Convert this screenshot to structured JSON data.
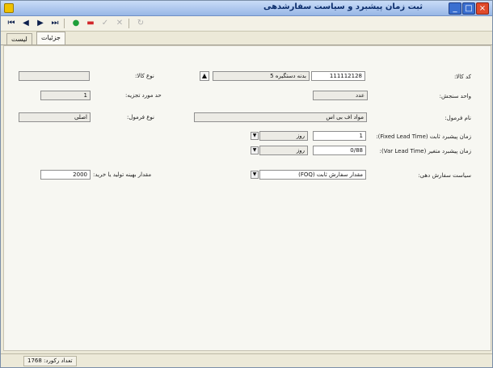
{
  "window": {
    "title": "ثبت زمان پیشبرد و سیاست سفارشدهی",
    "close": "×",
    "maximize": "□",
    "minimize": "_"
  },
  "toolbar": {
    "first": "⏮",
    "prev": "◀",
    "next": "▶",
    "last": "⏭",
    "add": "●",
    "delete": "▬",
    "confirm": "✓",
    "cancel": "✕",
    "refresh": "↻"
  },
  "tabs": [
    {
      "label": "جزئیات"
    },
    {
      "label": "لیست"
    }
  ],
  "form": {
    "item_code": {
      "label": "کد کالا:",
      "value": "111112128"
    },
    "item_name": {
      "value": "بدنه دستگیره 5"
    },
    "item_type": {
      "label": "نوع کالا:",
      "value": ""
    },
    "unit": {
      "label": "واحد سنجش:",
      "value": "عدد"
    },
    "min_part": {
      "label": "حد مورد تجزیه:",
      "value": "1"
    },
    "formula_name": {
      "label": "نام فرمول:",
      "value": "مواد اف بی اس"
    },
    "formula_type": {
      "label": "نوع فرمول:",
      "value": "اصلی"
    },
    "fixed_lead": {
      "label": "زمان پیشبرد ثابت (Fixed Lead Time):",
      "value": "1",
      "unit": "روز"
    },
    "var_lead": {
      "label": "زمان پیشبرد متغیر (Var Lead Time):",
      "value": "0/88",
      "unit": "روز"
    },
    "order_policy": {
      "label": "سیاست سفارش دهی:",
      "value": "مقدار سفارش ثابت (FOQ)"
    },
    "order_qty": {
      "label": "مقدار بهینه تولید یا خرید:",
      "value": "2000"
    }
  },
  "status": {
    "records": "تعداد رکورد: 1768"
  }
}
